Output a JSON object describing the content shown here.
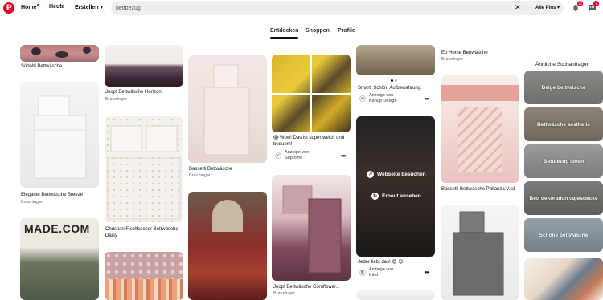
{
  "header": {
    "logo": "P",
    "nav_home": "Home",
    "nav_today": "Heute",
    "nav_create": "Erstellen",
    "search_value": "bettbezug",
    "search_clear": "✕",
    "filter_label": "Alle Pins",
    "notifications_count": "10",
    "messages_count": "1"
  },
  "tabs": [
    "Entdecken",
    "Shoppen",
    "Profile"
  ],
  "pins": {
    "c1_top_title": "Södahl Bettwäsche",
    "c1_mid_title": "Elegante Bettwäsche Breeze",
    "c1_mid_sub": "Brauninger",
    "c1_bot_label": "MADE.COM",
    "c2_top_title": "Joop! Bettwäsche Horizon",
    "c2_top_sub": "Brauninger",
    "c2_mid_title_1": "Christian Fischbacher Bettwäsche",
    "c2_mid_title_2": "Daisy",
    "c3_top_title": "Bassetti Bettwäsche",
    "c3_top_sub": "Brauninger",
    "c4_top_title_1": "😱 Wow! Das ist super weich und",
    "c4_top_title_2": "bequem!",
    "c4_ad_label": "Anzeige von",
    "c4_ad_brand": "Supromo",
    "c4_mid_title": "Joop! Bettwäsche Cornflower...",
    "c4_mid_sub": "Brauninger",
    "c5_top_title": "Smart. Schön. Aufbewahrung.",
    "c5_ad_label": "Anzeige von",
    "c5_ad_brand": "Kanup Design",
    "c5_overlay_visit": "Webseite besuchen",
    "c5_overlay_replay": "Erneut ansehen",
    "c5_mid_title": "Jeder liebt das! 😍 😊",
    "c5_ad2_label": "Anzeige von",
    "c5_ad2_brand": "Kitrd",
    "c6_top_title": "Eb Home Bettwäsche",
    "c6_top_sub": "Brauninger",
    "c6_mid_title": "Bassetti Bettwäsche Pallanza V.p1",
    "more": "•••"
  },
  "suggestions": {
    "title": "Ähnliche Suchanfragen",
    "items": [
      "Beige bettwäsche",
      "Bettwäsche aesthetic",
      "Bettbezug ideen",
      "Bett dekoration tagesdecke",
      "Schöne bettwäsche"
    ]
  },
  "icons": {
    "bell": "bell-icon",
    "chat": "chat-icon",
    "chevron": "chevron-down-icon",
    "more": "more-icon"
  },
  "colors": {
    "brand": "#e60023",
    "search_bg": "#efefef"
  }
}
